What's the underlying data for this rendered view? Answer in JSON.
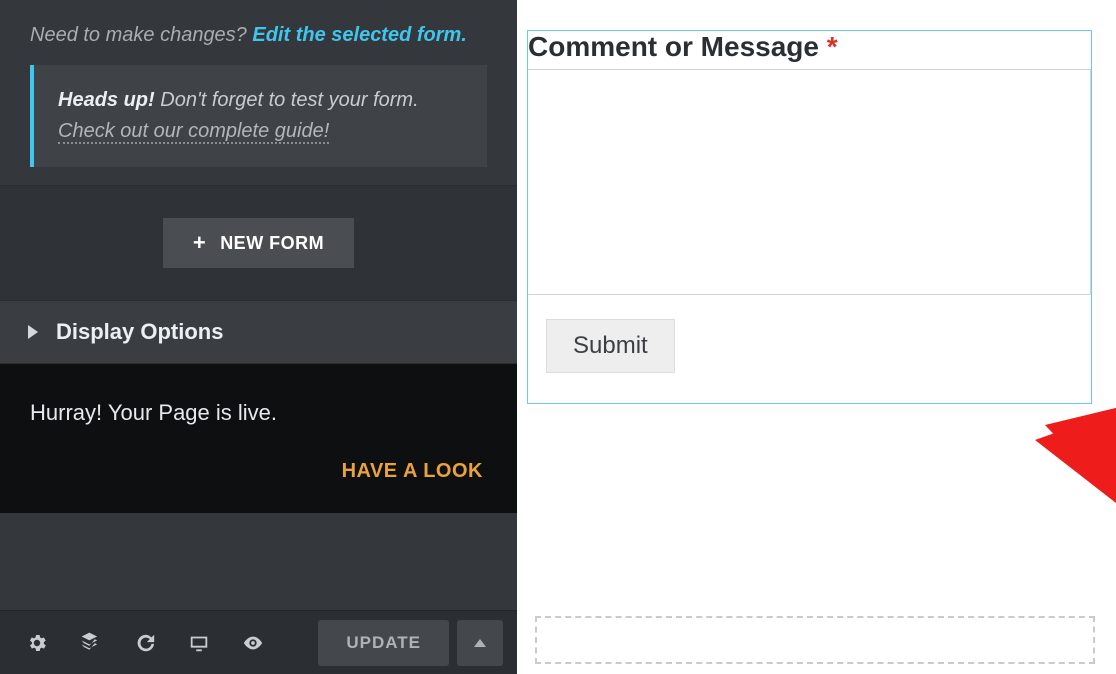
{
  "sidebar": {
    "changes_prompt": "Need to make changes?",
    "changes_link": "Edit the selected form.",
    "headsup_strong": "Heads up!",
    "headsup_text": "Don't forget to test your form.",
    "headsup_link": "Check out our complete guide!",
    "new_form_label": "NEW FORM",
    "display_options_label": "Display Options",
    "live_text": "Hurray! Your Page is live.",
    "have_a_look": "HAVE A LOOK",
    "update_label": "UPDATE"
  },
  "form": {
    "field_label": "Comment or Message",
    "required_mark": "*",
    "submit_label": "Submit"
  }
}
